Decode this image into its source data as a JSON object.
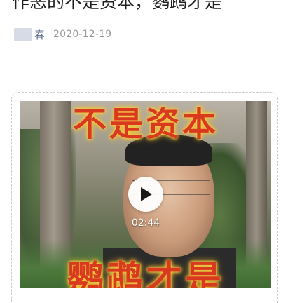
{
  "article": {
    "title": "作恶的不是资本，鹦鹉才是",
    "author": "春",
    "date": "2020-12-19"
  },
  "video": {
    "overlay_top": "不是资本",
    "overlay_bottom": "鹦鹉才是",
    "duration": "02:44",
    "play_icon": "play-icon"
  },
  "colors": {
    "title": "#1f1f1f",
    "author": "#5b6b8c",
    "date": "#9a9a9a",
    "overlay_text": "#d93a1f",
    "overlay_glow": "#f6d34a"
  }
}
